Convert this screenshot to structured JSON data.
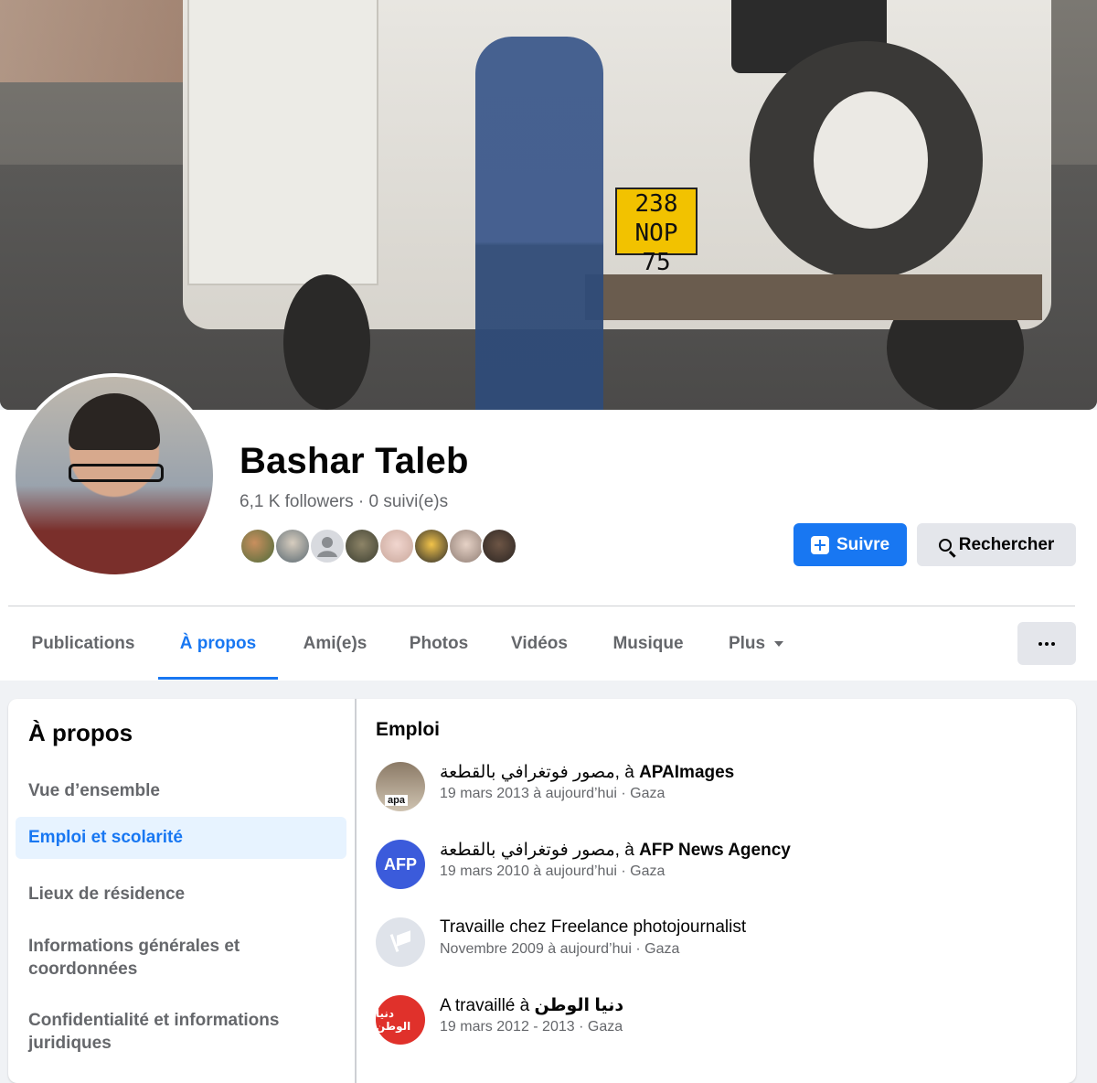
{
  "cover": {
    "plate_top": "238",
    "plate_bottom": "NOP 75"
  },
  "profile": {
    "name": "Bashar Taleb",
    "followers": "6,1 K followers",
    "separator": "·",
    "following": "0 suivi(e)s"
  },
  "actions": {
    "follow_label": "Suivre",
    "search_label": "Rechercher"
  },
  "tabs": [
    {
      "label": "Publications"
    },
    {
      "label": "À propos"
    },
    {
      "label": "Ami(e)s"
    },
    {
      "label": "Photos"
    },
    {
      "label": "Vidéos"
    },
    {
      "label": "Musique"
    },
    {
      "label": "Plus"
    }
  ],
  "sidebar": {
    "title": "À propos",
    "items": [
      {
        "label": "Vue d’ensemble"
      },
      {
        "label": "Emploi et scolarité"
      },
      {
        "label": "Lieux de résidence"
      },
      {
        "label": "Informations générales et coordonnées"
      },
      {
        "label": "Confidentialité et informations juridiques"
      }
    ]
  },
  "main": {
    "title": "Emploi",
    "jobs": [
      {
        "title_pre": "مصور فوتغرافي بالقطعة, à ",
        "title_org": "APAImages",
        "dates": "19 mars 2013 à aujourd’hui · Gaza",
        "logo_text": "apa"
      },
      {
        "title_pre": "مصور فوتغرافي بالقطعة, à ",
        "title_org": "AFP News Agency",
        "dates": "19 mars 2010 à aujourd’hui · Gaza",
        "logo_text": "AFP"
      },
      {
        "title_pre": "Travaille chez Freelance photojournalist",
        "title_org": "",
        "dates": "Novembre 2009 à aujourd’hui · Gaza",
        "logo_text": ""
      },
      {
        "title_pre": "A travaillé à ",
        "title_org": "دنيا الوطن",
        "dates": "19 mars 2012 - 2013 · Gaza",
        "logo_text": "دنيا الوطن"
      }
    ]
  },
  "colors": {
    "accent": "#1877f2",
    "muted": "#65676b",
    "background": "#f0f2f5"
  }
}
